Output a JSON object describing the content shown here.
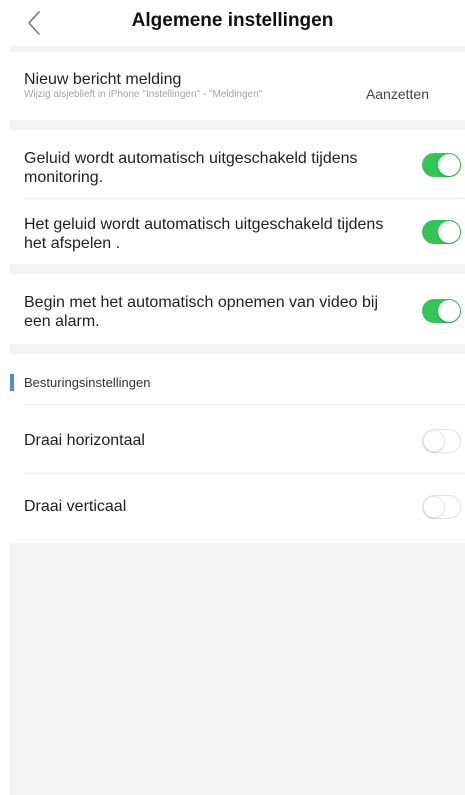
{
  "header": {
    "title": "Algemene instellingen",
    "back_icon": "chevron-left-icon"
  },
  "notification": {
    "label": "Nieuw bericht melding",
    "hint": "Wijzig alsjeblieft in iPhone \"Instellingen\" - \"Meldingen\"",
    "value": "Aanzetten"
  },
  "settings": [
    {
      "label": "Geluid wordt automatisch uitgeschakeld tijdens monitoring.",
      "on": true
    },
    {
      "label": "Het geluid wordt automatisch uitgeschakeld tijdens het afspelen .",
      "on": true
    },
    {
      "label": "Begin met het automatisch opnemen van video bij een alarm.",
      "on": true
    }
  ],
  "control_section": {
    "title": "Besturingsinstellingen",
    "accent_color": "#4a89e8",
    "items": [
      {
        "label": "Draai horizontaal",
        "on": false
      },
      {
        "label": "Draai verticaal",
        "on": false
      }
    ]
  },
  "colors": {
    "toggle_on": "#35c45a",
    "background": "#f3f3f3"
  }
}
